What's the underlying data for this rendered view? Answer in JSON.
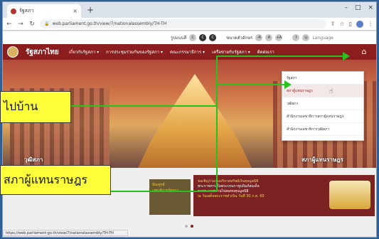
{
  "browser": {
    "tab_title": "รัฐสภา",
    "tab_close": "×",
    "new_tab": "+",
    "url": "web.parliament.go.th/view/7/nationalassembly/TH-TH",
    "status_url": "https://web.parliament.go.th/view/7/nationalassembly/TH-TH",
    "window_controls": [
      "–",
      "□",
      "×"
    ]
  },
  "top_strip": {
    "mode_label": "รูปแบบสี",
    "mode_buttons": [
      "C",
      "C",
      "C"
    ],
    "size_label": "ขนาดตัวอักษร",
    "size_buttons": [
      "-A",
      "A",
      "+A"
    ],
    "language": "Language"
  },
  "navbar": {
    "brand": "รัฐสภาไทย",
    "items": [
      "เกี่ยวกับรัฐสภา ▾",
      "การประชุมร่วมกันของรัฐสภา ▾",
      "คณะกรรมาธิการ ▾",
      "เครือข่ายกับรัฐสภา ▾",
      "ติดต่อเรา"
    ],
    "home_icon": "⌂"
  },
  "dropdown": {
    "items": [
      "รัฐสภา",
      "สภาผู้แทนราษฎร",
      "วุฒิสภา",
      "สำนักงานเลขาธิการสภาผู้แทนราษฎร",
      "สำนักงานเลขาธิการวุฒิสภา"
    ]
  },
  "hero": {
    "left_label": "วุฒิสภา",
    "right_label": "สภาผู้แทนราษฎร"
  },
  "band": {
    "card_left_line1": "ปัณฑูรย์",
    "card_left_line2": "เลขาธิการรัฐสภา",
    "card_mid_line1": "ขอเชิญร่วมกันบริจาคทรัพย์เงินทุนมูลนิธิ",
    "card_mid_line2": "พระราชทานในพระบรมราชูปถัมภ์สมเด็จ",
    "card_mid_line3": "ขอพระราชทานไปสมทบทุนมูลนิธิ",
    "card_mid_line4": "ณ วันเสด็จพระราชดำเนิน วันที่ 30 ก.ค. 65"
  },
  "annotations": {
    "callout_1": "ไปบ้าน",
    "callout_2": "สภาผู้แทนราษฎร",
    "arrow_color": "#28c21f",
    "callout_color": "#ffff3a"
  },
  "colors": {
    "brand": "#8a1d1d",
    "accent_gold": "#d9b262"
  }
}
